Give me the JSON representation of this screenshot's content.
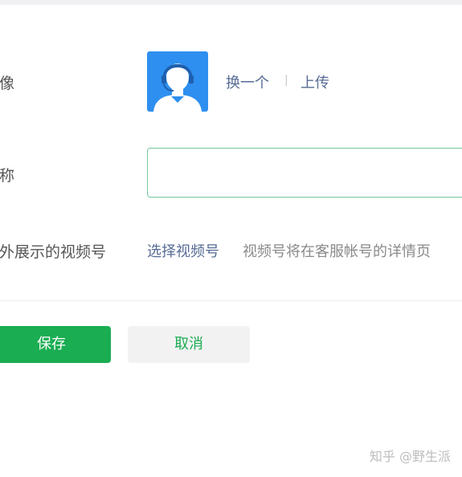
{
  "form": {
    "avatar_label": "头像",
    "avatar_change": "换一个",
    "avatar_separator": "|",
    "avatar_upload": "上传",
    "name_label": "名称",
    "name_value": "",
    "channel_label": "对外展示的视频号",
    "channel_select": "选择视频号",
    "channel_hint": "视频号将在客服帐号的详情页"
  },
  "actions": {
    "save": "保存",
    "cancel": "取消"
  },
  "watermark": "知乎 @野生派",
  "colors": {
    "primary_green": "#1aad52",
    "link_blue": "#576b95",
    "avatar_bg": "#2e8ff0"
  },
  "icons": {
    "avatar": "default-user-avatar-icon"
  }
}
